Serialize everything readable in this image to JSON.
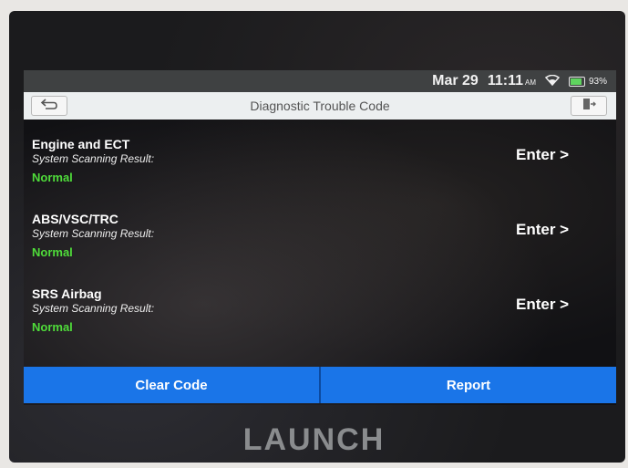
{
  "status_bar": {
    "date": "Mar 29",
    "time": "11:11",
    "ampm": "AM",
    "battery": "93%",
    "battery_level": 0.93,
    "battery_color": "#5fd35f",
    "icons": [
      "wifi-icon",
      "battery-icon"
    ]
  },
  "header": {
    "title": "Diagnostic Trouble Code",
    "back_icon": "back-arrow-icon",
    "exit_icon": "exit-icon"
  },
  "systems": [
    {
      "name": "Engine and ECT",
      "subtitle": "System Scanning Result:",
      "status": "Normal",
      "action": "Enter >"
    },
    {
      "name": "ABS/VSC/TRC",
      "subtitle": "System Scanning Result:",
      "status": "Normal",
      "action": "Enter >"
    },
    {
      "name": "SRS Airbag",
      "subtitle": "System Scanning Result:",
      "status": "Normal",
      "action": "Enter >"
    }
  ],
  "footer": {
    "clear_label": "Clear Code",
    "report_label": "Report",
    "accent_color": "#1a75e8"
  },
  "brand": "LAUNCH",
  "colors": {
    "status_normal": "#4fdc3a"
  }
}
